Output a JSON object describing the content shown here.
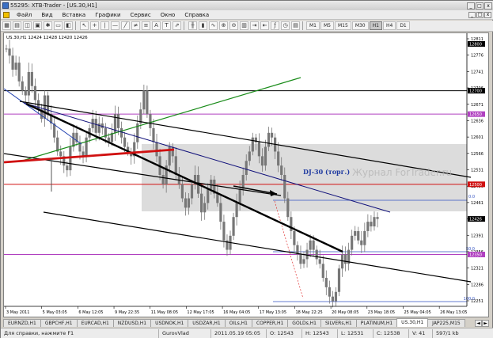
{
  "window": {
    "title": "55295: XTB-Trader - [US.30,H1]",
    "min_label": "_",
    "max_label": "□",
    "close_label": "x"
  },
  "menu": {
    "items": [
      "Файл",
      "Вид",
      "Вставка",
      "Графики",
      "Сервис",
      "Окно",
      "Справка"
    ],
    "mdi_min": "_",
    "mdi_restore": "□",
    "mdi_close": "x"
  },
  "toolbar": {
    "timeframes": [
      "M1",
      "M5",
      "M15",
      "M30",
      "H1",
      "H4",
      "D1"
    ],
    "active_timeframe": "H1"
  },
  "chart": {
    "header": "US.30,H1  12424 12428 12420 12426",
    "annotation": "DJ-30 (торг.)",
    "watermark": "Журнал ForTrader.ru",
    "fibo_labels": [
      "0.0",
      "50.0",
      "100.0"
    ],
    "price_ticks": [
      "12811",
      "12776",
      "12741",
      "12706",
      "12671",
      "12636",
      "12601",
      "12566",
      "12531",
      "12496",
      "12461",
      "12426",
      "12391",
      "12356",
      "12321",
      "12286",
      "12251"
    ],
    "highlighted_prices": {
      "black": "12700",
      "purple_top": "12650",
      "red": "12500",
      "current": "12426",
      "purple_bottom": "12350",
      "top_black": "12800"
    },
    "time_labels": [
      "3 May 2011",
      "5 May 03:05",
      "6 May 12:05",
      "9 May 22:35",
      "11 May 08:05",
      "12 May 17:05",
      "16 May 04:05",
      "17 May 13:05",
      "18 May 22:25",
      "20 May 08:05",
      "23 May 18:05",
      "25 May 04:05",
      "26 May 13:05"
    ],
    "colors": {
      "candles": "#777777",
      "channel": "#000000",
      "green_line": "#1a8c1a",
      "blue_line": "#10107a",
      "red_line": "#d01010",
      "purple_level": "#b040c0",
      "zone": "#dcdcdc",
      "annotation": "#1f3aa0"
    }
  },
  "tabs": {
    "items": [
      "EURNZD,H1",
      "GBPCHF,H1",
      "EURCAD,H1",
      "NZDUSD,H1",
      "USDNOK,H1",
      "USDZAR,H1",
      "OILs,H1",
      "COPPER,H1",
      "GOLDs,H1",
      "SILVERs,H1",
      "PLATINUM,H1",
      "US.30,H1",
      "JAP225,M15"
    ],
    "active": "US.30,H1",
    "scroll_left": "◄",
    "scroll_right": "►"
  },
  "status": {
    "help": "Для справки, нажмите F1",
    "profile": "GurovVlad",
    "datetime": "2011.05.19 05:05",
    "open": "O: 12543",
    "high": "H: 12543",
    "low": "L: 12531",
    "close": "C: 12538",
    "volume": "V: 41",
    "traffic": "597/1 kb"
  }
}
